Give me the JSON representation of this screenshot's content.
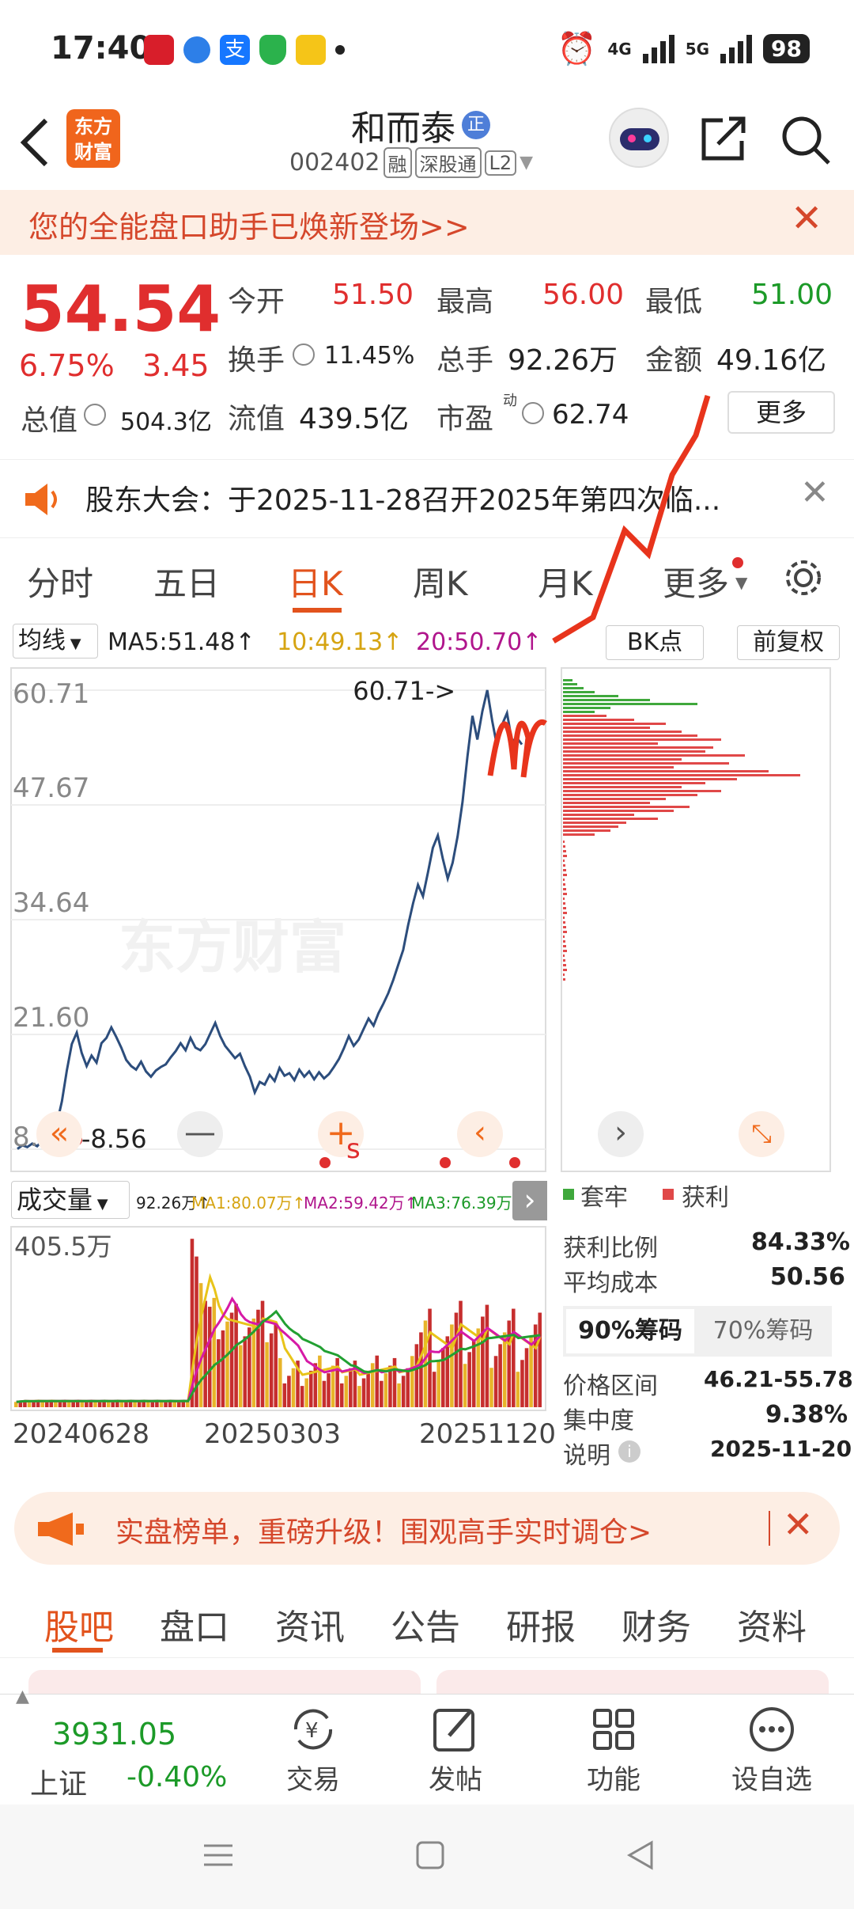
{
  "status_bar": {
    "time": "17:40",
    "network1": "4G",
    "network2": "5G",
    "battery": "98"
  },
  "header": {
    "logo_line1": "东方",
    "logo_line2": "财富",
    "stock_name": "和而泰",
    "name_badge": "正",
    "stock_code": "002402",
    "tag1": "融",
    "tag2": "深股通",
    "tag3": "L2"
  },
  "promo": {
    "text": "您的全能盘口助手已焕新登场>>"
  },
  "quote": {
    "price": "54.54",
    "change_pct": "6.75%",
    "change_amt": "3.45",
    "open_label": "今开",
    "open_value": "51.50",
    "high_label": "最高",
    "high_value": "56.00",
    "low_label": "最低",
    "low_value": "51.00",
    "turnover_label": "换手",
    "turnover_value": "11.45%",
    "volume_label": "总手",
    "volume_value": "92.26万",
    "amount_label": "金额",
    "amount_value": "49.16亿",
    "mcap_label": "总值",
    "mcap_value": "504.3亿",
    "float_label": "流值",
    "float_value": "439.5亿",
    "pe_label": "市盈",
    "pe_sup": "动",
    "pe_value": "62.74",
    "more_button": "更多"
  },
  "notice": {
    "text": "股东大会：于2025-11-28召开2025年第四次临..."
  },
  "chart_tabs": [
    "分时",
    "五日",
    "日K",
    "周K",
    "月K",
    "更多"
  ],
  "chart_tabs_active": 2,
  "ma_bar": {
    "dropdown": "均线",
    "ma5": "MA5:51.48↑",
    "ma10": "10:49.13↑",
    "ma20": "20:50.70↑",
    "bk_button": "BK点",
    "adjust_button": "前复权"
  },
  "kline": {
    "y_labels": [
      "60.71",
      "47.67",
      "34.64",
      "21.60",
      "8.56"
    ],
    "max_marker": "60.71->",
    "min_marker": "<-8.56",
    "watermark": "东方财富",
    "buy_sell_mark": "s"
  },
  "volume_bar": {
    "dropdown": "成交量",
    "vol": "92.26万↑",
    "ma1": "MA1:80.07万↑",
    "ma2": "MA2:59.42万↑",
    "ma3": "MA3:76.39万↓",
    "y_max": "405.5万",
    "dates": [
      "20240628",
      "20250303",
      "20251120"
    ]
  },
  "chip": {
    "legend_trapped": "套牢",
    "legend_profit": "获利",
    "profit_ratio_label": "获利比例",
    "profit_ratio_value": "84.33%",
    "avg_cost_label": "平均成本",
    "avg_cost_value": "50.56",
    "tab_90": "90%筹码",
    "tab_70": "70%筹码",
    "range_label": "价格区间",
    "range_value": "46.21-55.78",
    "concentration_label": "集中度",
    "concentration_value": "9.38%",
    "note_label": "说明",
    "note_value": "2025-11-20"
  },
  "banner": {
    "text": "实盘榜单，重磅升级！围观高手实时调仓>"
  },
  "sub_tabs": [
    "股吧",
    "盘口",
    "资讯",
    "公告",
    "研报",
    "财务",
    "资料"
  ],
  "bottom_nav": {
    "index_value": "3931.05",
    "index_name": "上证",
    "index_change": "-0.40%",
    "trade": "交易",
    "post": "发帖",
    "functions": "功能",
    "watchlist": "设自选"
  },
  "colors": {
    "up": "#e02e2e",
    "down": "#1c9a28",
    "accent": "#f06a1c",
    "price_line": "#2c4d7c"
  },
  "chart_data": {
    "type": "line",
    "y_ticks": [
      60.71,
      47.67,
      34.64,
      21.6,
      8.56
    ],
    "ylim": [
      8.56,
      60.71
    ],
    "x_start": "20240628",
    "x_end": "20251120",
    "max": 60.71,
    "min": 8.56,
    "close_series": [
      8.6,
      9.0,
      8.8,
      9.2,
      8.9,
      9.5,
      9.1,
      10.2,
      11.5,
      14,
      17.5,
      20.5,
      21.8,
      19.5,
      18,
      19.2,
      18.4,
      20.6,
      21.2,
      22.4,
      21.3,
      20.1,
      18.7,
      18,
      17.6,
      18.5,
      17.4,
      16.8,
      17.5,
      17.9,
      18.2,
      19,
      19.7,
      20.6,
      19.8,
      21.2,
      20.1,
      19.8,
      20.5,
      21.7,
      22.9,
      21.4,
      20.3,
      19.6,
      18.9,
      19.4,
      18,
      16.8,
      15,
      16.2,
      15.9,
      17,
      16.3,
      17.8,
      16.9,
      17.2,
      16.4,
      17.6,
      16.8,
      17.4,
      16.5,
      17.3,
      16.6,
      17.1,
      17.9,
      18.8,
      20,
      21.4,
      20.3,
      21,
      22.2,
      23.4,
      22.6,
      24,
      25.1,
      26.3,
      27.8,
      29.5,
      31.2,
      34,
      36.5,
      38.6,
      37.3,
      40,
      42.8,
      44.2,
      41.6,
      39.3,
      41.1,
      44.1,
      48,
      53.2,
      57.8,
      55.1,
      58.3,
      60.71,
      57.2,
      54.3,
      56.8,
      58.1,
      54.9,
      55.3,
      54.54
    ]
  }
}
